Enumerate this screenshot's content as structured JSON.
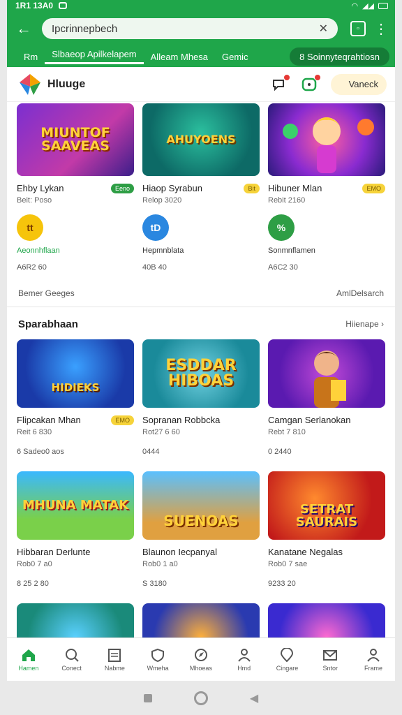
{
  "status": {
    "time": "1R1 13A0",
    "icons": [
      "wifi-icon",
      "signal-icon",
      "battery-icon"
    ]
  },
  "browser": {
    "url": "Ipcrinnepbech",
    "tabs": [
      "Rm",
      "Slbaeop Apilkelapem",
      "Alleam Mhesa",
      "Gemic"
    ],
    "pill": "8 Soinnyteqrahtiosn"
  },
  "app": {
    "title": "Hluuge",
    "vbutton": "Vaneck"
  },
  "top_cards": [
    {
      "art": "MIUNTOF SAAVEAS",
      "name": "Ehby Lykan",
      "badge": "Eeno",
      "badge_color": "green",
      "sub": "Beit: Poso",
      "circle_color": "#f6c40b",
      "circle_text": "tt",
      "link": "Aeonnhflaan",
      "link_color": "#1fa64a",
      "meta": "A6R2 60"
    },
    {
      "art": "AHUYOENS",
      "name": "Hiaop Syrabun",
      "badge": "Bit",
      "badge_color": "yellow",
      "sub": "Relop 3020",
      "circle_color": "#2a87e0",
      "circle_text": "tD",
      "link": "Hepmnblata",
      "link_color": "#333",
      "meta": "40B 40"
    },
    {
      "art": "",
      "name": "Hibuner Mlan",
      "badge": "EMO",
      "badge_color": "yellow",
      "sub": "Rebit 2160",
      "circle_color": "#2e9e45",
      "circle_text": "%",
      "link": "Sonmnflamen",
      "link_color": "#333",
      "meta": "A6C2 30"
    }
  ],
  "footer_row": {
    "left": "Bemer Geeges",
    "right": "AmlDelsarch"
  },
  "section": {
    "title": "Sparabhaan",
    "more": "Hiienape"
  },
  "grid_cards": [
    {
      "art": "HIDIEKS",
      "name": "Flipcakan Mhan",
      "badge": "EMO",
      "sub": "Reit 6 830",
      "meta": "6 Sadeo0 aos"
    },
    {
      "art": "ESDDAR HIBOAS",
      "name": "Sopranan Robbcka",
      "badge": "",
      "sub": "Rot27 6 60",
      "meta": "0444"
    },
    {
      "art": "",
      "name": "Camgan Serlanokan",
      "badge": "",
      "sub": "Rebt 7 810",
      "meta": "0 2440"
    },
    {
      "art": "MHUNA MATAK",
      "name": "Hibbaran Derlunte",
      "badge": "",
      "sub": "Rob0 7 a0",
      "meta": "8 25 2 80"
    },
    {
      "art": "SUENOAS",
      "name": "Blaunon Iecpanyal",
      "badge": "",
      "sub": "Rob0 1 a0",
      "meta": "S 3180"
    },
    {
      "art": "SETRAT SAURAIS",
      "name": "Kanatane Negalas",
      "badge": "",
      "sub": "Rob0 7 sae",
      "meta": "9233 20"
    },
    {
      "art": "",
      "name": "",
      "badge": "",
      "sub": "",
      "meta": ""
    },
    {
      "art": "",
      "name": "",
      "badge": "",
      "sub": "",
      "meta": ""
    },
    {
      "art": "",
      "name": "",
      "badge": "",
      "sub": "",
      "meta": ""
    }
  ],
  "bottom_nav": [
    "Hamen",
    "Conect",
    "Nabme",
    "Wmeha",
    "Mhoeas",
    "Hmd",
    "Cingare",
    "Sntor",
    "Frame"
  ]
}
